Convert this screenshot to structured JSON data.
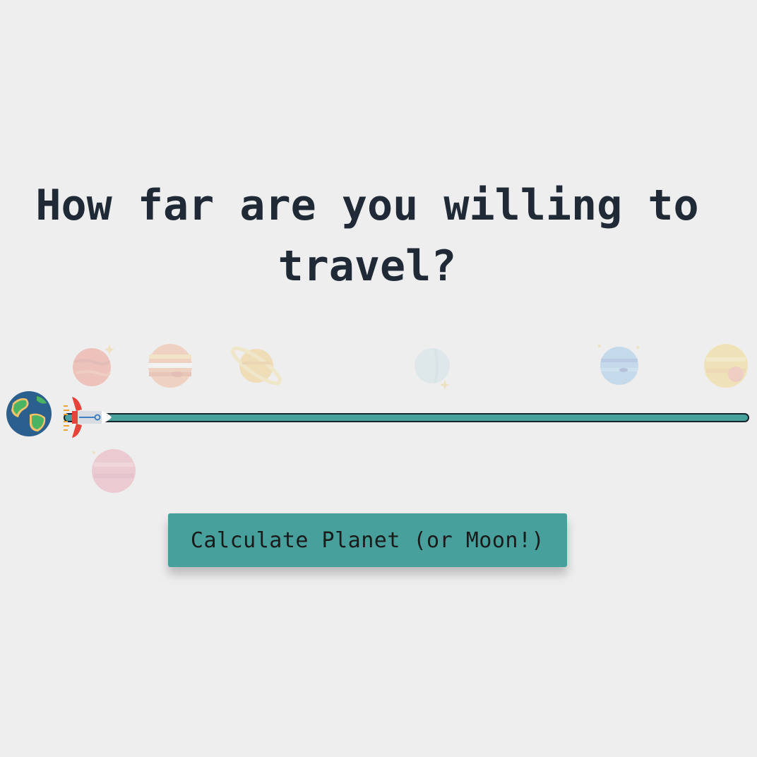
{
  "headline": "How far are you willing to travel?",
  "distance_slider": {
    "value": 0,
    "unit": "fraction"
  },
  "calculate_button_label": "Calculate Planet (or Moon!)",
  "colors": {
    "background": "#eeeeee",
    "accent_teal": "#47a09c",
    "heading_text": "#1f2a36"
  },
  "icons": [
    "earth-icon",
    "rocket-icon",
    "mars-icon",
    "jupiter-icon",
    "saturn-icon",
    "uranus-icon",
    "neptune-icon",
    "sun-icon",
    "pink-planet-icon"
  ]
}
